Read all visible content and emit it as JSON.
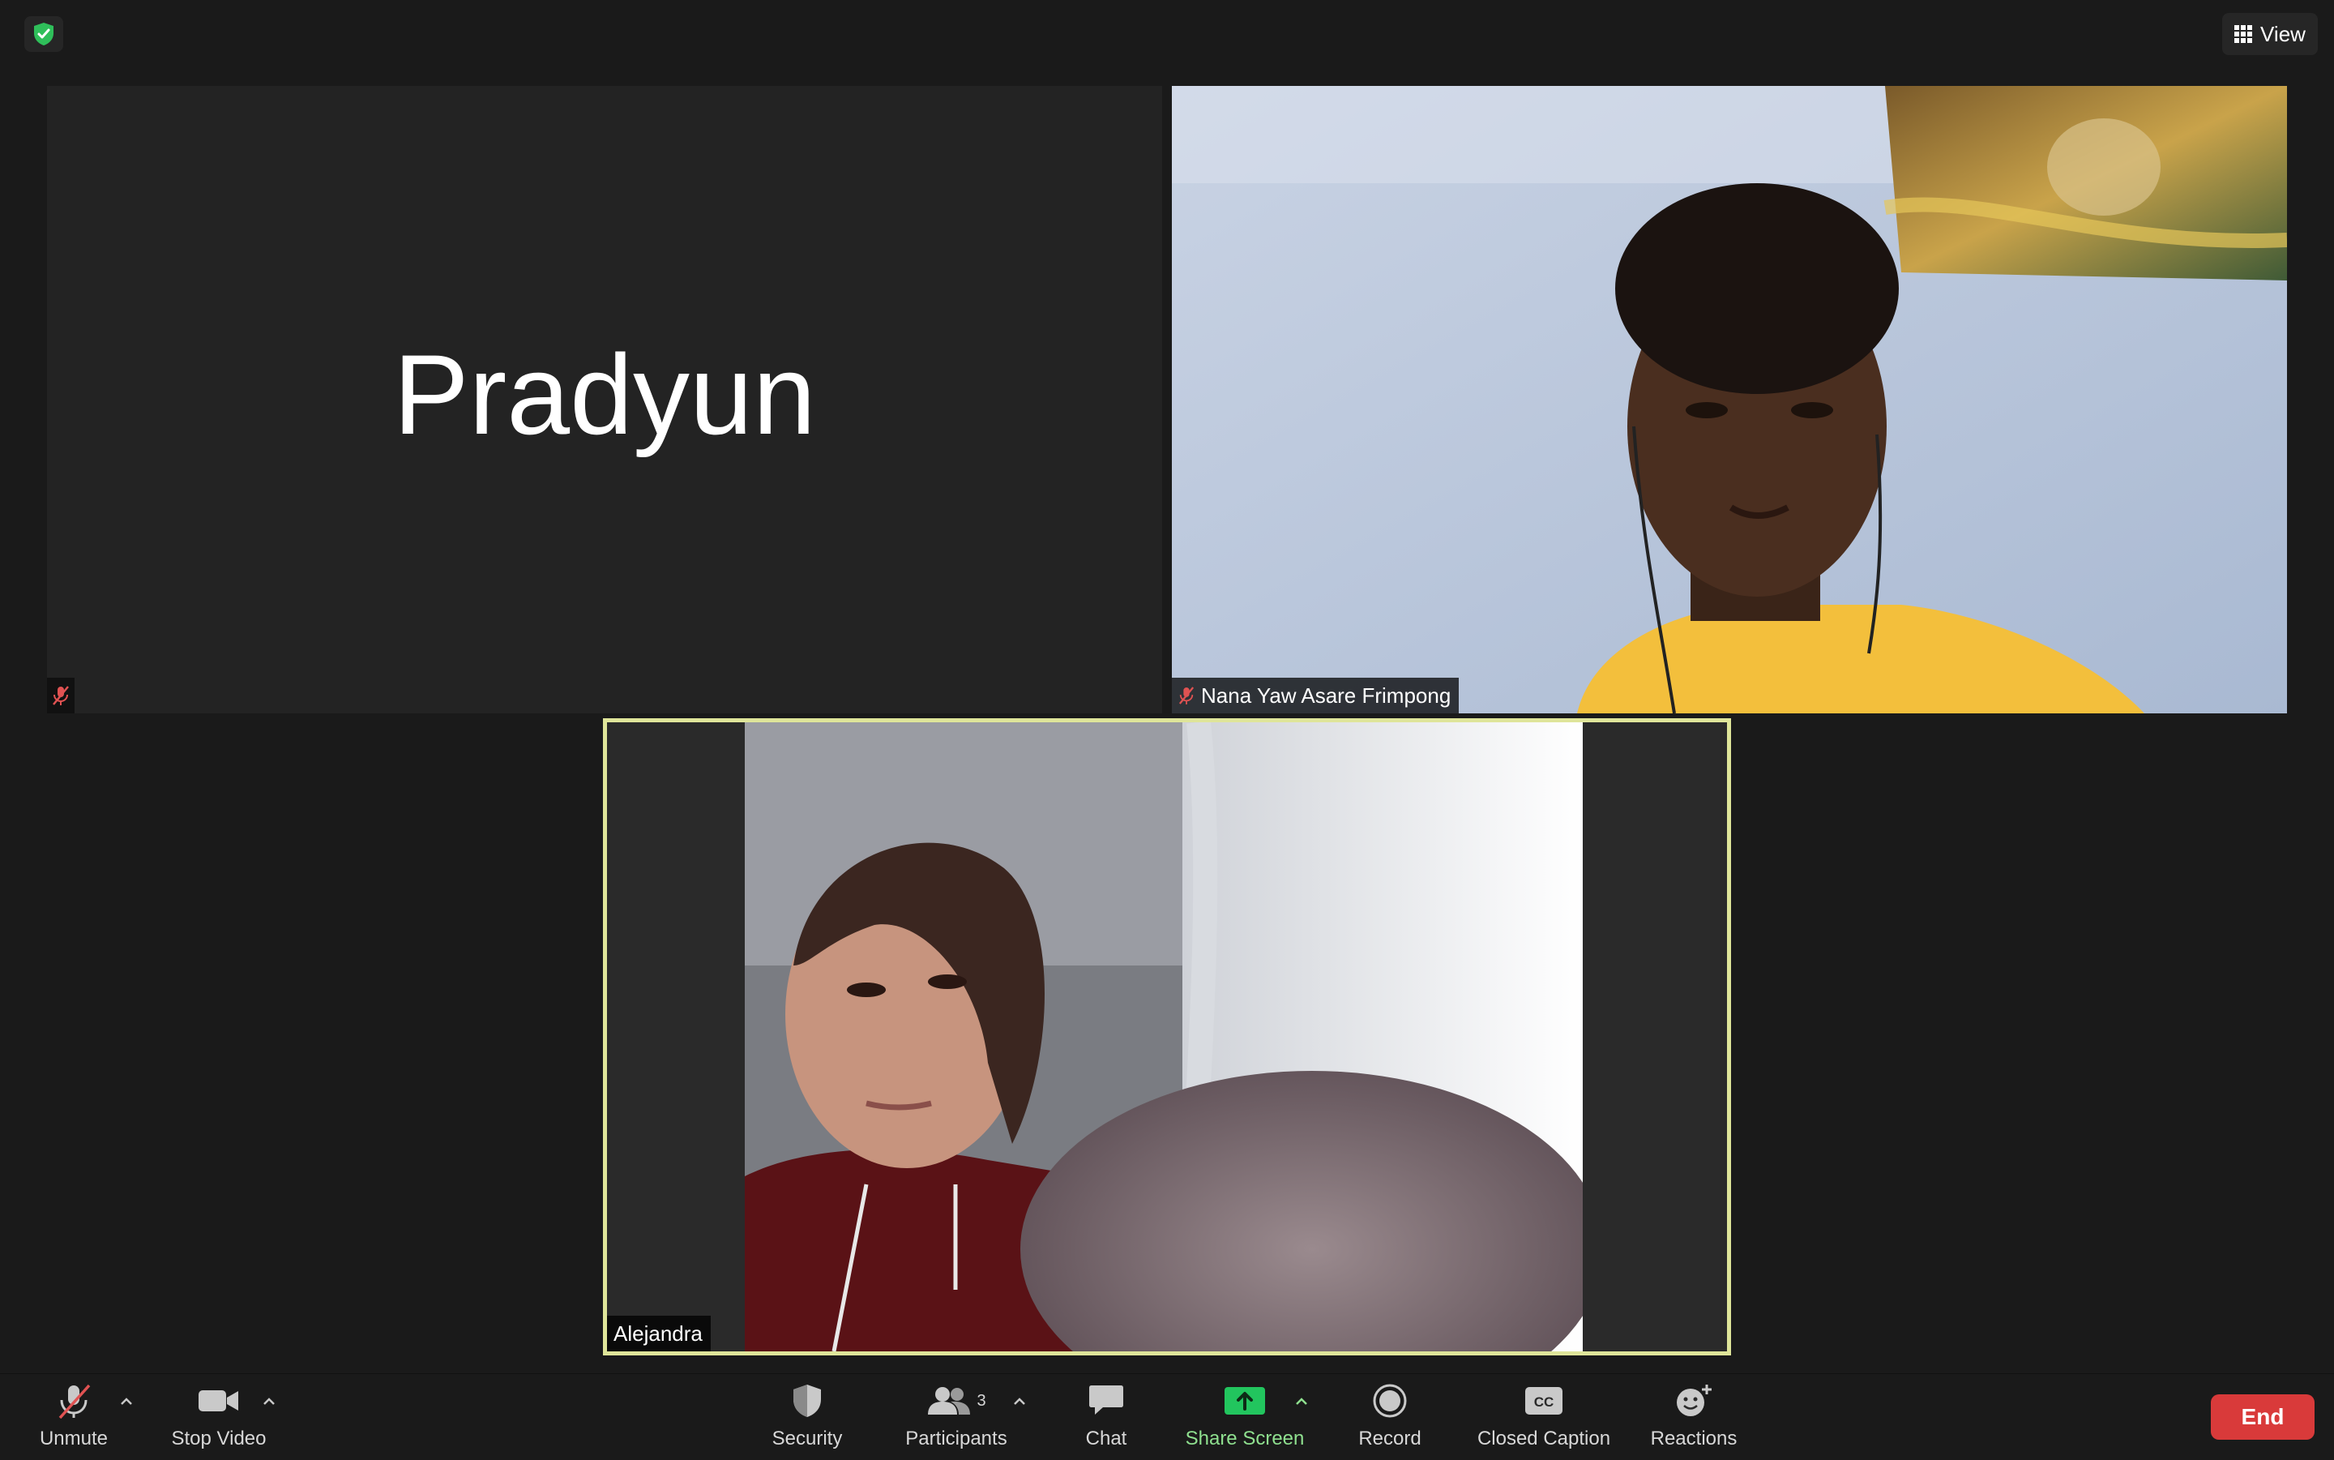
{
  "top_bar": {
    "view_label": "View"
  },
  "participants": [
    {
      "name": "Pradyun",
      "display_name": "Pradyun",
      "muted": true,
      "video": false
    },
    {
      "name": "Nana Yaw Asare Frimpong",
      "muted": true,
      "video": true
    },
    {
      "name": "Alejandra",
      "muted": false,
      "video": true,
      "active_speaker": true
    }
  ],
  "toolbar": {
    "unmute": "Unmute",
    "stop_video": "Stop Video",
    "security": "Security",
    "participants": "Participants",
    "participants_count": "3",
    "chat": "Chat",
    "share_screen": "Share Screen",
    "record": "Record",
    "closed_caption": "Closed Caption",
    "reactions": "Reactions",
    "end": "End"
  },
  "colors": {
    "background": "#1a1a1a",
    "tile": "#232323",
    "active_speaker_border": "#dfe59a",
    "share_green": "#22c55e",
    "end_red": "#d93a3a",
    "muted_red": "#e05252"
  }
}
